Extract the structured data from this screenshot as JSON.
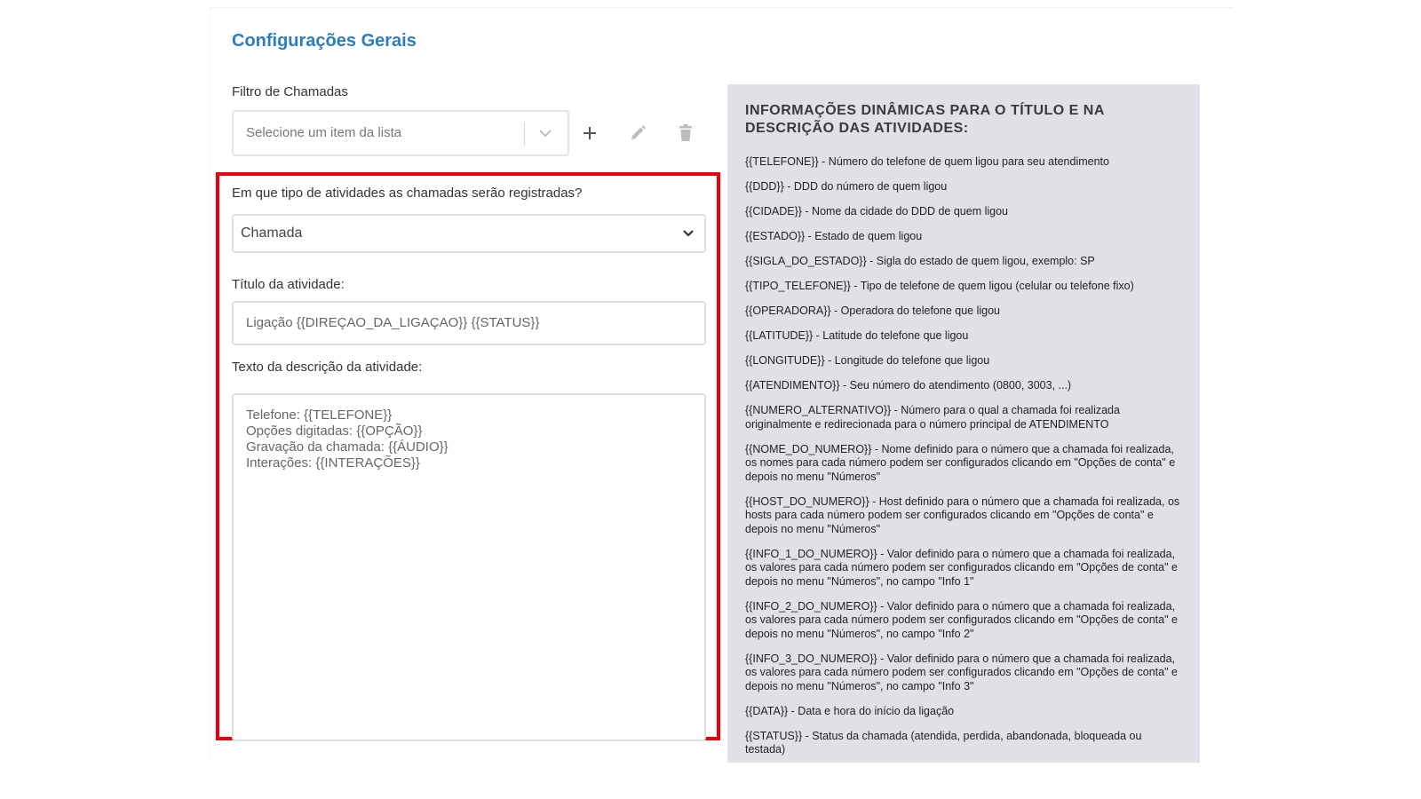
{
  "settings": {
    "title": "Configurações Gerais",
    "filter": {
      "label": "Filtro de Chamadas",
      "placeholder": "Selecione um item da lista"
    },
    "activity_type": {
      "label": "Em que tipo de atividades as chamadas serão registradas?",
      "value": "Chamada"
    },
    "activity_title": {
      "label": "Título da atividade:",
      "value": "Ligação {{DIREÇAO_DA_LIGAÇAO}} {{STATUS}}"
    },
    "activity_description": {
      "label": "Texto da descrição da atividade:",
      "lines": [
        "Telefone: {{TELEFONE}}",
        "Opções digitadas: {{OPÇÃO}}",
        "Gravação da chamada: {{ÁUDIO}}",
        "Interações: {{INTERAÇÕES}}"
      ]
    }
  },
  "info_panel": {
    "heading": "INFORMAÇÕES DINÂMICAS PARA O TÍTULO E NA DESCRIÇÃO DAS ATIVIDADES:",
    "items": [
      "{{TELEFONE}} - Número do telefone de quem ligou para seu atendimento",
      "{{DDD}} - DDD do número de quem ligou",
      "{{CIDADE}} - Nome da cidade do DDD de quem ligou",
      "{{ESTADO}} - Estado de quem ligou",
      "{{SIGLA_DO_ESTADO}} - Sigla do estado de quem ligou, exemplo: SP",
      "{{TIPO_TELEFONE}} - Tipo de telefone de quem ligou (celular ou telefone fixo)",
      "{{OPERADORA}} - Operadora do telefone que ligou",
      "{{LATITUDE}} - Latitude do telefone que ligou",
      "{{LONGITUDE}} - Longitude do telefone que ligou",
      "{{ATENDIMENTO}} - Seu número do atendimento (0800, 3003, ...)",
      "{{NUMERO_ALTERNATIVO}} - Número para o qual a chamada foi realizada originalmente e redirecionada para o número principal de ATENDIMENTO",
      "{{NOME_DO_NUMERO}} - Nome definido para o número que a chamada foi realizada, os nomes para cada número podem ser configurados clicando em \"Opções de conta\" e depois no menu \"Números\"",
      "{{HOST_DO_NUMERO}} - Host definido para o número que a chamada foi realizada, os hosts para cada número podem ser configurados clicando em \"Opções de conta\" e depois no menu \"Números\"",
      "{{INFO_1_DO_NUMERO}} - Valor definido para o número que a chamada foi realizada, os valores para cada número podem ser configurados clicando em \"Opções de conta\" e depois no menu \"Números\", no campo \"Info 1\"",
      "{{INFO_2_DO_NUMERO}} - Valor definido para o número que a chamada foi realizada, os valores para cada número podem ser configurados clicando em \"Opções de conta\" e depois no menu \"Números\", no campo \"Info 2\"",
      "{{INFO_3_DO_NUMERO}} - Valor definido para o número que a chamada foi realizada, os valores para cada número podem ser configurados clicando em \"Opções de conta\" e depois no menu \"Números\", no campo \"Info 3\"",
      "{{DATA}} - Data e hora do início da ligação",
      "{{STATUS}} - Status da chamada (atendida, perdida, abandonada, bloqueada ou testada)"
    ]
  },
  "colors": {
    "accent": "#2b7cc1",
    "highlight": "#e8000d",
    "panel_bg": "#dfe1e6"
  },
  "icons": {
    "filter_dropdown": "chevron-down-icon",
    "add": "plus-icon",
    "edit": "pencil-icon",
    "delete": "trash-icon",
    "type_dropdown": "chevron-down-icon"
  }
}
